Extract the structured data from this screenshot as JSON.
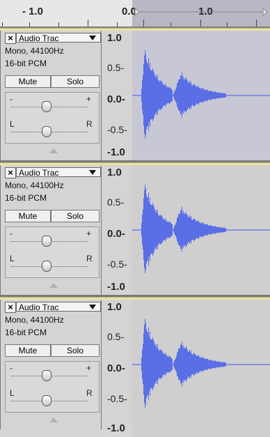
{
  "ruler": {
    "labels": [
      "- 1.0",
      "0.0",
      "1.0"
    ]
  },
  "tracks": [
    {
      "title": "Audio Trac",
      "close_glyph": "×",
      "info_line1": "Mono, 44100Hz",
      "info_line2": "16-bit PCM",
      "mute_label": "Mute",
      "solo_label": "Solo",
      "gain_minus": "-",
      "gain_plus": "+",
      "pan_left": "L",
      "pan_right": "R",
      "scale": [
        "1.0",
        "0.5-",
        "0.0-",
        "-0.5-",
        "-1.0"
      ]
    },
    {
      "title": "Audio Trac",
      "close_glyph": "×",
      "info_line1": "Mono, 44100Hz",
      "info_line2": "16-bit PCM",
      "mute_label": "Mute",
      "solo_label": "Solo",
      "gain_minus": "-",
      "gain_plus": "+",
      "pan_left": "L",
      "pan_right": "R",
      "scale": [
        "1.0",
        "0.5-",
        "0.0-",
        "-0.5-",
        "-1.0"
      ]
    },
    {
      "title": "Audio Trac",
      "close_glyph": "×",
      "info_line1": "Mono, 44100Hz",
      "info_line2": "16-bit PCM",
      "mute_label": "Mute",
      "solo_label": "Solo",
      "gain_minus": "-",
      "gain_plus": "+",
      "pan_left": "L",
      "pan_right": "R",
      "scale": [
        "1.0",
        "0.5-",
        "0.0-",
        "-0.5-",
        "-1.0"
      ]
    }
  ],
  "colors": {
    "waveform": "#5a6ee6",
    "waveform_bg": "#c8c8d4",
    "selection": "#b8b8c4",
    "track_top_border": "#eae2a8"
  }
}
